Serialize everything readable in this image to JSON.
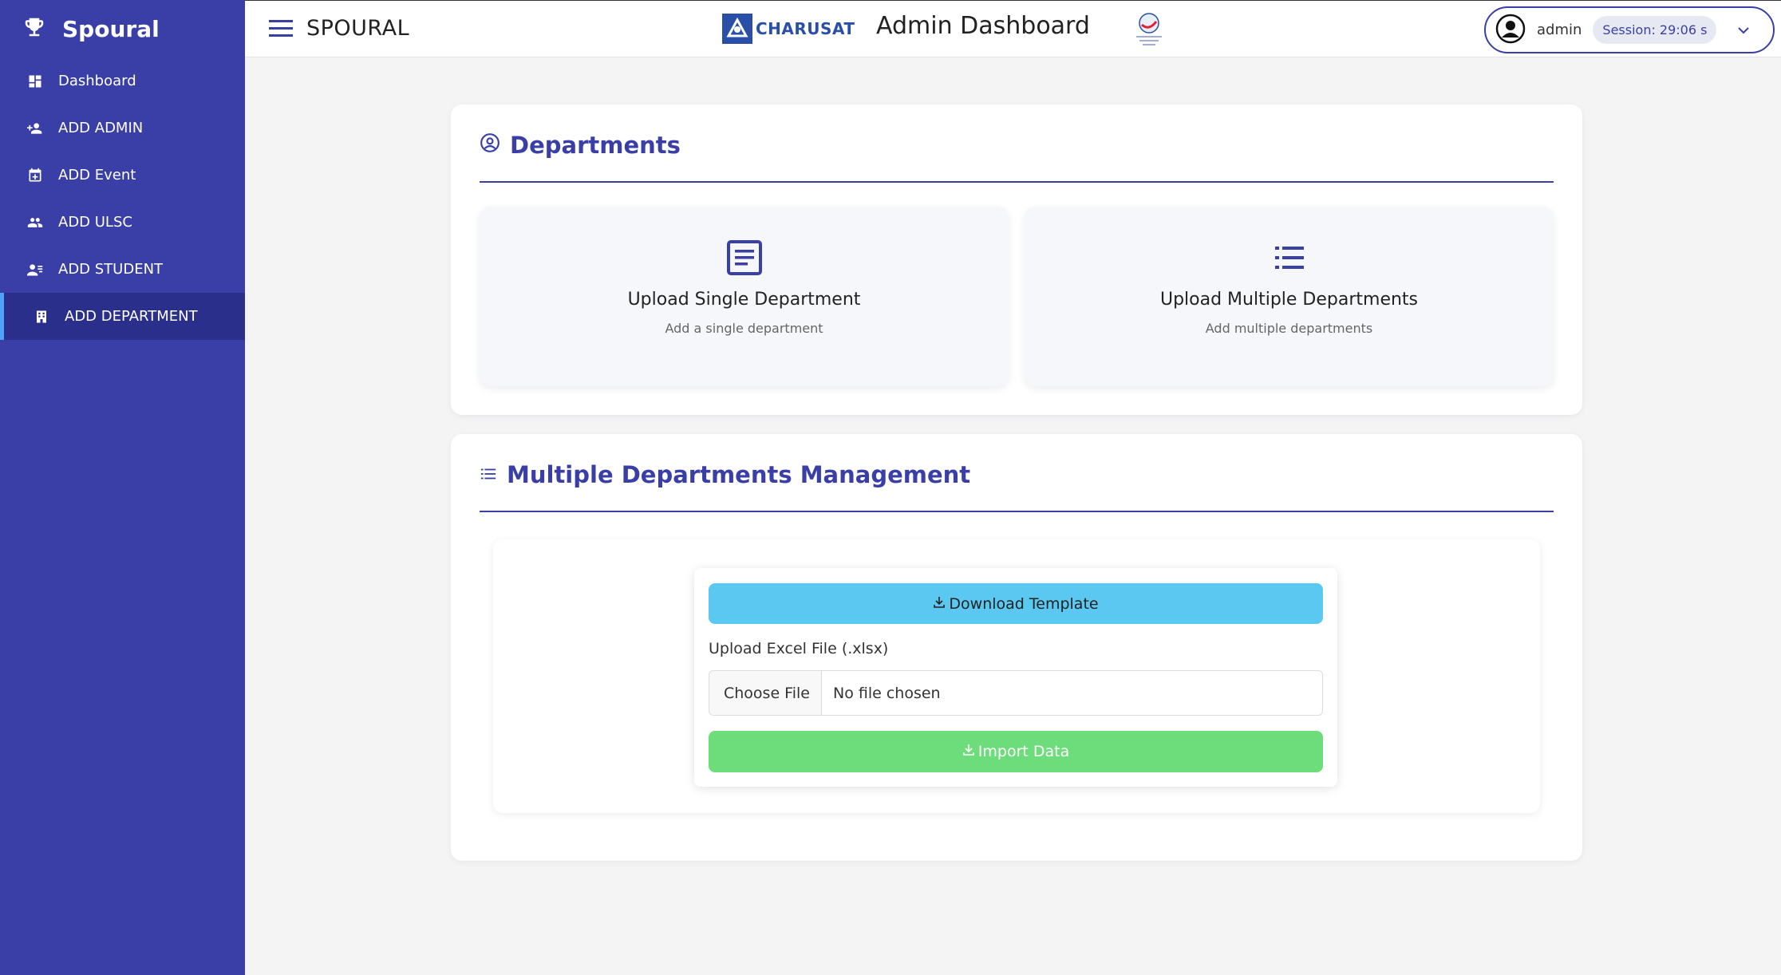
{
  "sidebar": {
    "brand": "Spoural",
    "items": [
      {
        "label": "Dashboard"
      },
      {
        "label": "ADD ADMIN"
      },
      {
        "label": "ADD Event"
      },
      {
        "label": "ADD ULSC"
      },
      {
        "label": "ADD STUDENT"
      },
      {
        "label": "ADD DEPARTMENT"
      }
    ]
  },
  "header": {
    "app_name": "SPOURAL",
    "charusat_text": "CHARUSAT",
    "title": "Admin Dashboard",
    "user_name": "admin",
    "session": "Session: 29:06 s"
  },
  "departments": {
    "heading": "Departments",
    "tiles": [
      {
        "title": "Upload Single Department",
        "subtitle": "Add a single department"
      },
      {
        "title": "Upload Multiple Departments",
        "subtitle": "Add multiple departments"
      }
    ]
  },
  "multi": {
    "heading": "Multiple Departments Management",
    "download_label": "Download Template",
    "upload_label": "Upload Excel File (.xlsx)",
    "choose_file": "Choose File",
    "no_file": "No file chosen",
    "import_label": "Import Data"
  },
  "colors": {
    "sidebar": "#3a3fa7",
    "active_item": "#2a2f8c",
    "download_button": "#5bc8f2",
    "import_button": "#6ddd7b"
  }
}
